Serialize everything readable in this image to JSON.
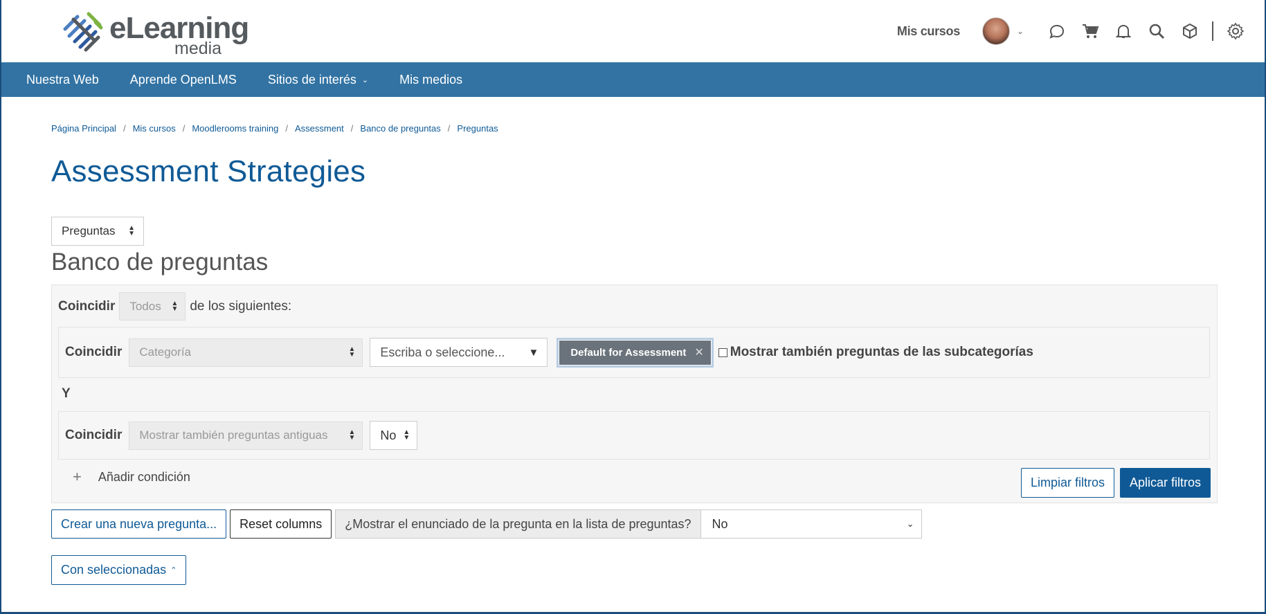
{
  "brand": {
    "name_main": "eLearning",
    "name_sub": "media"
  },
  "header": {
    "mis_cursos": "Mis cursos"
  },
  "nav": [
    {
      "label": "Nuestra Web"
    },
    {
      "label": "Aprende OpenLMS"
    },
    {
      "label": "Sitios de interés"
    },
    {
      "label": "Mis medios"
    }
  ],
  "breadcrumb": [
    "Página Principal",
    "Mis cursos",
    "Moodlerooms training",
    "Assessment",
    "Banco de preguntas",
    "Preguntas"
  ],
  "page_title": "Assessment Strategies",
  "view_select": "Preguntas",
  "section_title": "Banco de preguntas",
  "filter": {
    "match_label": "Coincidir",
    "match_all": "Todos",
    "of_following": "de los siguientes:",
    "cond1": {
      "label": "Coincidir",
      "field": "Categoría",
      "placeholder": "Escriba o seleccione...",
      "tag": "Default for Assessment",
      "subcat_label": "Mostrar también preguntas de las subcategorías"
    },
    "and_label": "Y",
    "cond2": {
      "label": "Coincidir",
      "field": "Mostrar también preguntas antiguas",
      "value": "No"
    },
    "add_condition": "Añadir condición",
    "clear": "Limpiar filtros",
    "apply": "Aplicar filtros"
  },
  "actions": {
    "new_question": "Crear una nueva pregunta...",
    "reset_columns": "Reset columns",
    "show_text_label": "¿Mostrar el enunciado de la pregunta en la lista de preguntas?",
    "show_text_value": "No",
    "with_selected": "Con seleccionadas"
  },
  "colors": {
    "nav": "#3273a3",
    "primary": "#0f5a96"
  },
  "icons": [
    "logo-mark-icon",
    "chevron-down-icon",
    "chat-icon",
    "cart-icon",
    "bell-icon",
    "search-icon",
    "box-icon",
    "gear-icon",
    "plus-icon",
    "close-icon"
  ]
}
